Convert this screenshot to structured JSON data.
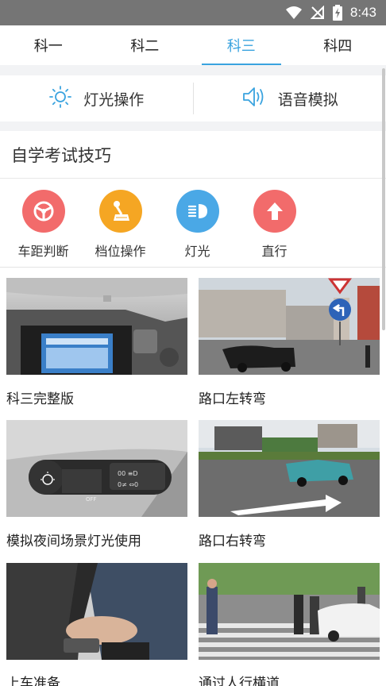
{
  "status_bar": {
    "time": "8:43"
  },
  "tabs": [
    {
      "label": "科一",
      "active": false
    },
    {
      "label": "科二",
      "active": false
    },
    {
      "label": "科三",
      "active": true
    },
    {
      "label": "科四",
      "active": false
    }
  ],
  "actions": {
    "light": {
      "label": "灯光操作",
      "icon": "sun-icon"
    },
    "voice": {
      "label": "语音模拟",
      "icon": "speaker-icon"
    }
  },
  "section": {
    "title": "自学考试技巧"
  },
  "tips": [
    {
      "label": "车距判断",
      "icon": "steering-wheel-icon",
      "color": "#f26b6b"
    },
    {
      "label": "档位操作",
      "icon": "gear-shift-icon",
      "color": "#f5a623"
    },
    {
      "label": "灯光",
      "icon": "headlight-icon",
      "color": "#4aa8e6"
    },
    {
      "label": "直行",
      "icon": "arrow-up-icon",
      "color": "#f26b6b"
    }
  ],
  "videos": [
    {
      "label": "科三完整版",
      "thumb": "car-dashboard-screen-photo"
    },
    {
      "label": "路口左转弯",
      "thumb": "intersection-left-turn-photo"
    },
    {
      "label": "模拟夜间场景灯光使用",
      "thumb": "light-switch-stalk-photo"
    },
    {
      "label": "路口右转弯",
      "thumb": "intersection-right-turn-photo"
    },
    {
      "label": "上车准备",
      "thumb": "seatbelt-photo"
    },
    {
      "label": "通过人行横道",
      "thumb": "crosswalk-photo"
    }
  ],
  "colors": {
    "accent": "#3aa3df",
    "status_bar": "#757575"
  }
}
